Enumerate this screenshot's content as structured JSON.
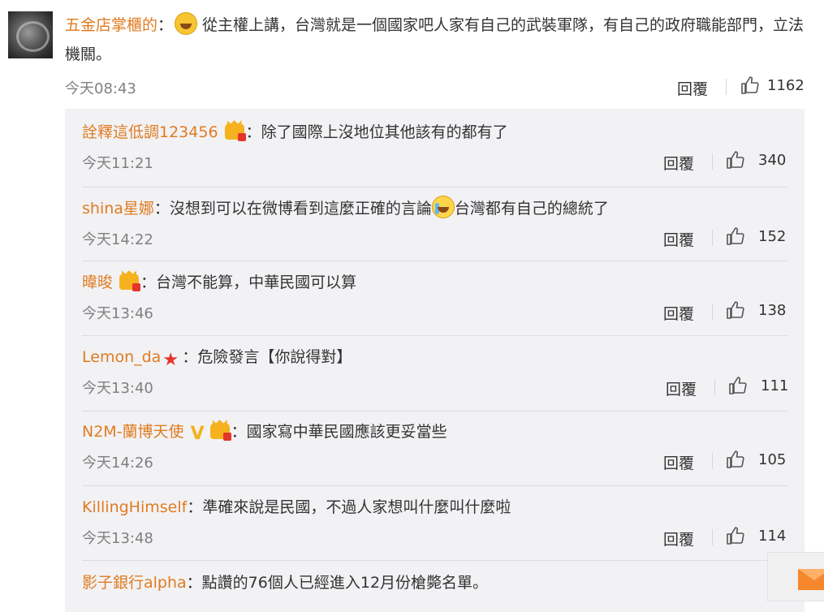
{
  "top_comment": {
    "username": "五金店掌櫃的",
    "colon": "：",
    "text": "從主權上講，台灣就是一個國家吧人家有自己的武裝軍隊，有自己的政府職能部門，立法機關。",
    "time": "今天08:43",
    "reply_label": "回覆",
    "likes": "1162"
  },
  "replies": [
    {
      "username": "詮釋這低調123456",
      "badge": "crown-icon",
      "text": "：除了國際上沒地位其他該有的都有了",
      "time": "今天11:21",
      "reply_label": "回覆",
      "likes": "340"
    },
    {
      "username": "shina星娜",
      "text_before": "：沒想到可以在微博看到這麼正確的言論",
      "text_after": "台灣都有自己的總統了",
      "time": "今天14:22",
      "reply_label": "回覆",
      "likes": "152"
    },
    {
      "username": "暐晙",
      "badge": "crown-icon",
      "text": "：台灣不能算，中華民國可以算",
      "time": "今天13:46",
      "reply_label": "回覆",
      "likes": "138"
    },
    {
      "username": "Lemon_da",
      "badge": "star-icon",
      "text": "：危險發言【你說得對】",
      "time": "今天13:40",
      "reply_label": "回覆",
      "likes": "111"
    },
    {
      "username": "N2M-蘭博天使",
      "badge": "vip-icon",
      "text": "：國家寫中華民國應該更妥當些",
      "time": "今天14:26",
      "reply_label": "回覆",
      "likes": "105"
    },
    {
      "username": "KillingHimself",
      "text": "：準確來說是民國，不過人家想叫什麼叫什麼啦",
      "time": "今天13:48",
      "reply_label": "回覆",
      "likes": "114"
    },
    {
      "username": "影子銀行alpha",
      "text": "：點讚的76個人已經進入12月份槍斃名單。"
    }
  ],
  "colors": {
    "username": "#e07b20",
    "panel": "#f2f2f5",
    "accent": "#f5872d"
  }
}
